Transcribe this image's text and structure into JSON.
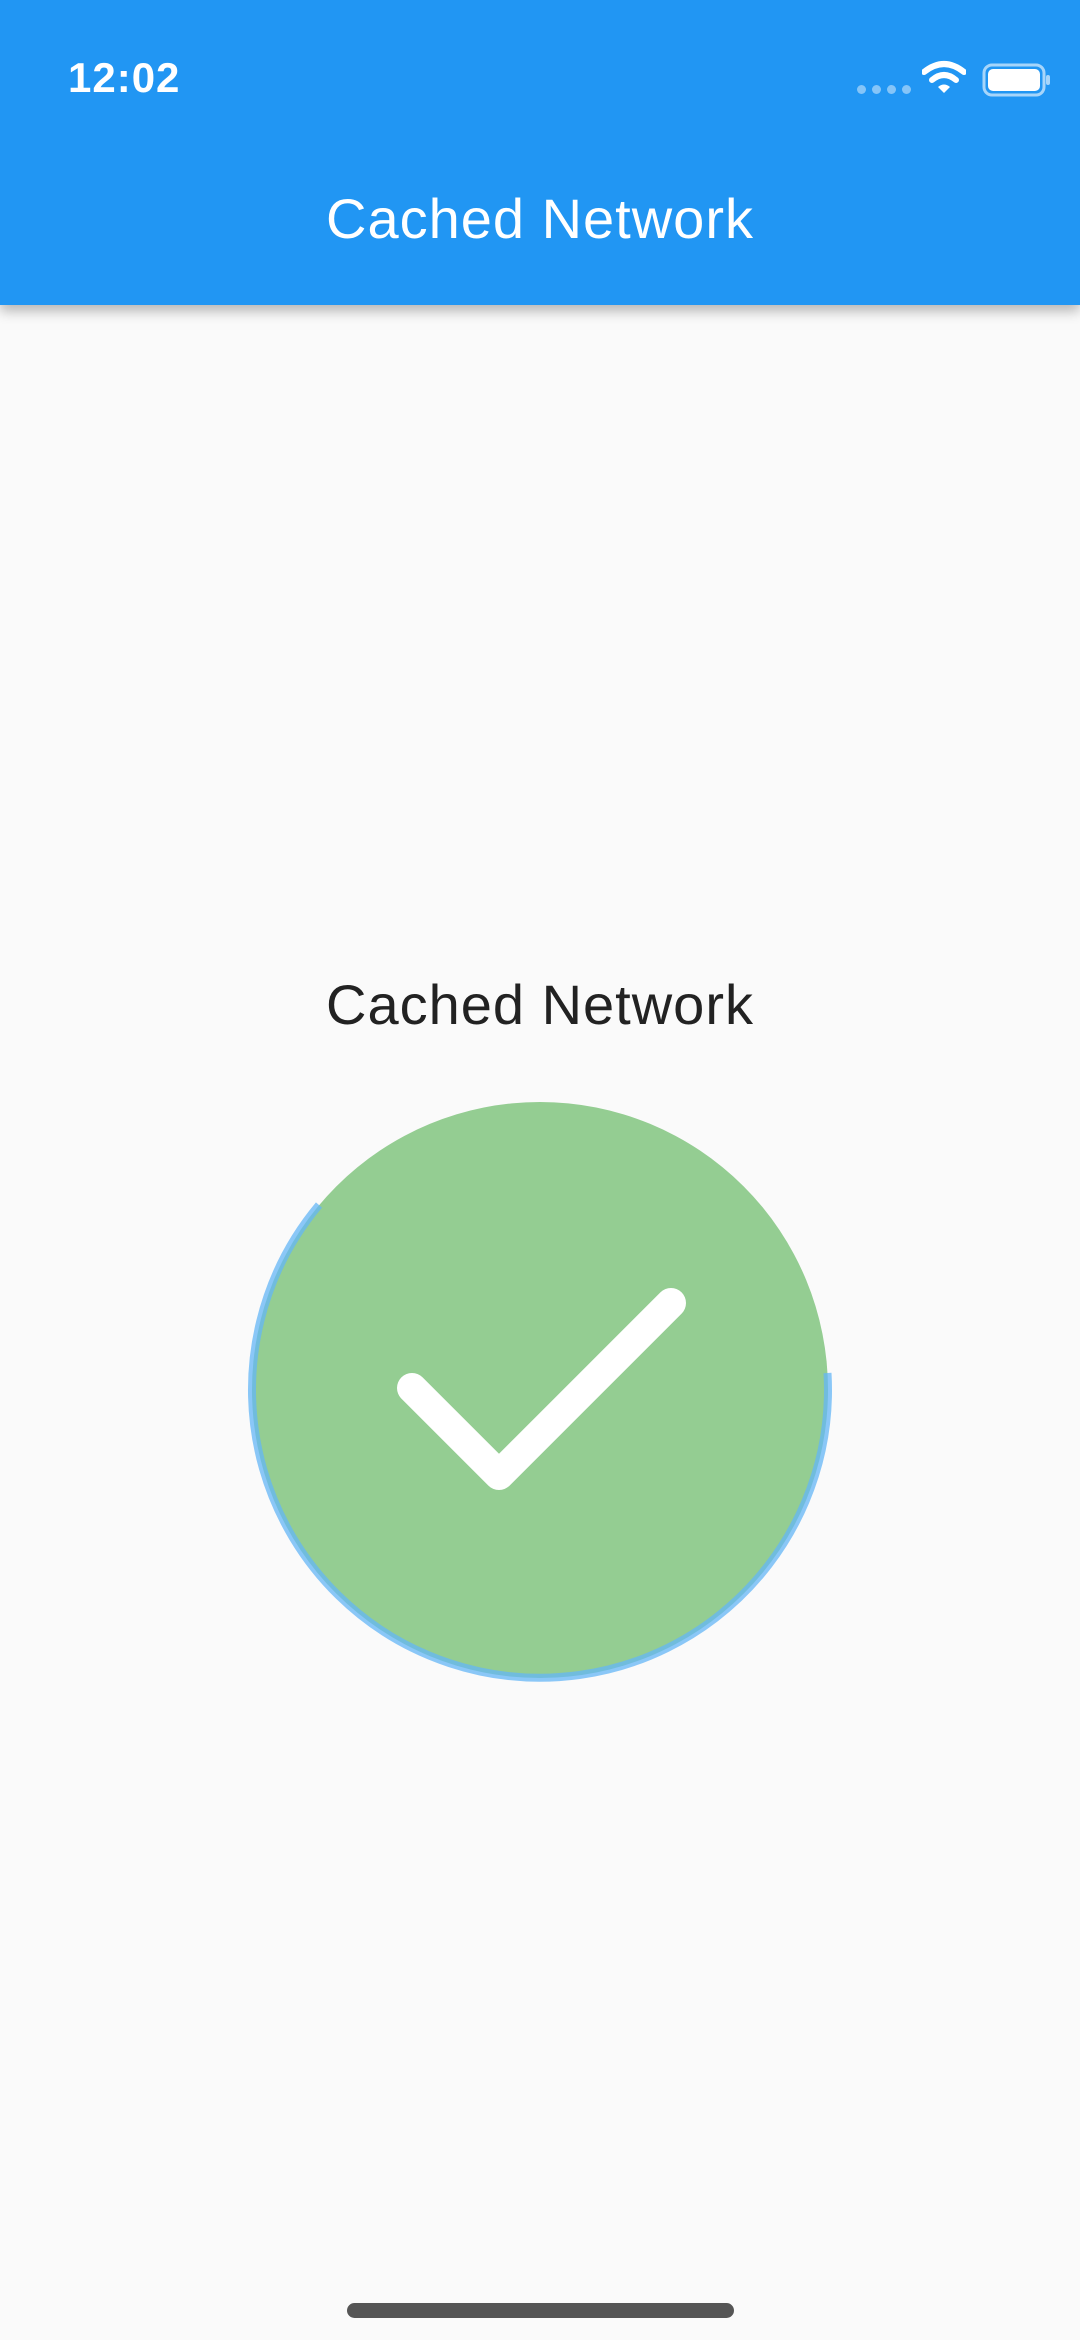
{
  "status_bar": {
    "time": "12:02"
  },
  "app_bar": {
    "title": "Cached Network"
  },
  "content": {
    "label": "Cached Network",
    "status_icon": "check-icon",
    "status_color": "#94cd92",
    "progress_ring_color": "#64b5f6"
  },
  "theme": {
    "primary": "#2196f3",
    "background": "#fafafa"
  }
}
